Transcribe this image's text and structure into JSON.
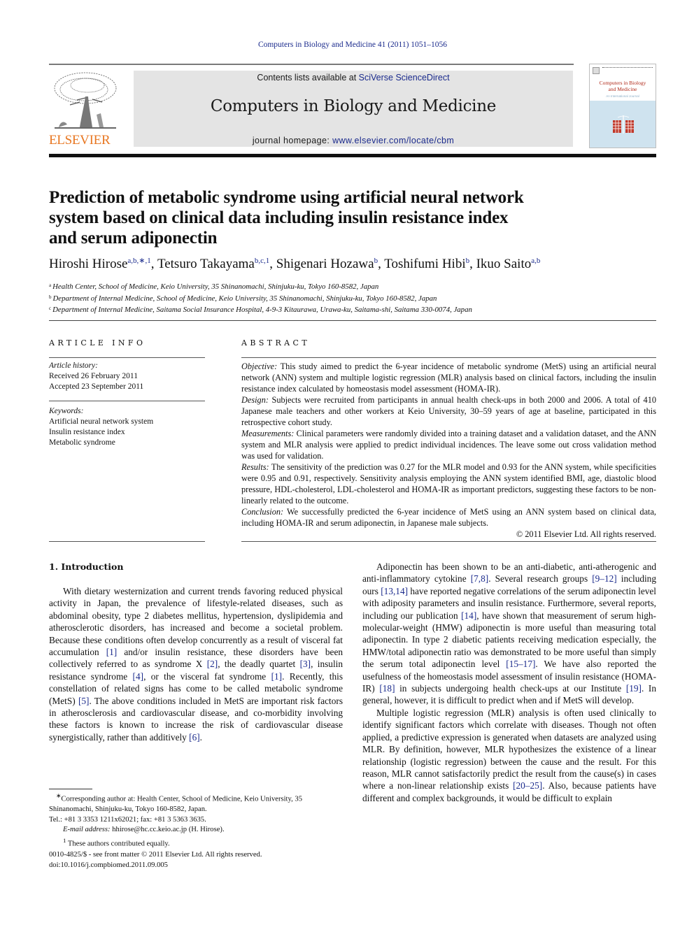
{
  "citation": "Computers in Biology and Medicine 41 (2011) 1051–1056",
  "masthead": {
    "publisher_logo_text": "ELSEVIER",
    "contents_prefix": "Contents lists available at ",
    "contents_link": "SciVerse ScienceDirect",
    "journal_title": "Computers in Biology and Medicine",
    "homepage_prefix": "journal homepage: ",
    "homepage_link": "www.elsevier.com/locate/cbm",
    "cover_title_line1": "Computers in Biology",
    "cover_title_line2": "and Medicine",
    "cover_subtitle": "An International Journal"
  },
  "title_lines": [
    "Prediction of metabolic syndrome using artificial neural network",
    "system based on clinical data including insulin resistance index",
    "and serum adiponectin"
  ],
  "authors": [
    {
      "name": "Hiroshi Hirose",
      "marks": "a,b,∗,1"
    },
    {
      "name": "Tetsuro Takayama",
      "marks": "b,c,1"
    },
    {
      "name": "Shigenari Hozawa",
      "marks": "b"
    },
    {
      "name": "Toshifumi Hibi",
      "marks": "b"
    },
    {
      "name": "Ikuo Saito",
      "marks": "a,b"
    }
  ],
  "affiliations": [
    {
      "mark": "a",
      "text": "Health Center, School of Medicine, Keio University, 35 Shinanomachi, Shinjuku-ku, Tokyo 160-8582, Japan"
    },
    {
      "mark": "b",
      "text": "Department of Internal Medicine, School of Medicine, Keio University, 35 Shinanomachi, Shinjuku-ku, Tokyo 160-8582, Japan"
    },
    {
      "mark": "c",
      "text": "Department of Internal Medicine, Saitama Social Insurance Hospital, 4-9-3 Kitaurawa, Urawa-ku, Saitama-shi, Saitama 330-0074, Japan"
    }
  ],
  "article_info": {
    "heading": "ARTICLE INFO",
    "history_label": "Article history:",
    "received": "Received 26 February 2011",
    "accepted": "Accepted 23 September 2011",
    "keywords_label": "Keywords:",
    "keywords": [
      "Artificial neural network system",
      "Insulin resistance index",
      "Metabolic syndrome"
    ]
  },
  "abstract": {
    "heading": "ABSTRACT",
    "sections": [
      {
        "label": "Objective:",
        "text": " This study aimed to predict the 6-year incidence of metabolic syndrome (MetS) using an artificial neural network (ANN) system and multiple logistic regression (MLR) analysis based on clinical factors, including the insulin resistance index calculated by homeostasis model assessment (HOMA-IR)."
      },
      {
        "label": "Design:",
        "text": " Subjects were recruited from participants in annual health check-ups in both 2000 and 2006. A total of 410 Japanese male teachers and other workers at Keio University, 30–59 years of age at baseline, participated in this retrospective cohort study."
      },
      {
        "label": "Measurements:",
        "text": " Clinical parameters were randomly divided into a training dataset and a validation dataset, and the ANN system and MLR analysis were applied to predict individual incidences. The leave some out cross validation method was used for validation."
      },
      {
        "label": "Results:",
        "text": " The sensitivity of the prediction was 0.27 for the MLR model and 0.93 for the ANN system, while specificities were 0.95 and 0.91, respectively. Sensitivity analysis employing the ANN system identified BMI, age, diastolic blood pressure, HDL-cholesterol, LDL-cholesterol and HOMA-IR as important predictors, suggesting these factors to be non-linearly related to the outcome."
      },
      {
        "label": "Conclusion:",
        "text": " We successfully predicted the 6-year incidence of MetS using an ANN system based on clinical data, including HOMA-IR and serum adiponectin, in Japanese male subjects."
      }
    ],
    "copyright": "© 2011 Elsevier Ltd. All rights reserved."
  },
  "introduction": {
    "heading": "1.   Introduction",
    "left_paragraph": [
      {
        "t": "With dietary westernization and current trends favoring reduced physical activity in Japan, the prevalence of lifestyle-related diseases, such as abdominal obesity, type 2 diabetes mellitus, hypertension, dyslipidemia and atherosclerotic disor­ders, has increased and become a societal problem. Because these conditions often develop concurrently as a result of visceral fat accumulation "
      },
      {
        "ref": "[1]"
      },
      {
        "t": " and/or insulin resistance, these disorders have been collectively referred to as syndrome X "
      },
      {
        "ref": "[2]"
      },
      {
        "t": ", the deadly quartet "
      },
      {
        "ref": "[3]"
      },
      {
        "t": ", insulin resistance syndrome "
      },
      {
        "ref": "[4]"
      },
      {
        "t": ", or the visceral fat syndrome "
      },
      {
        "ref": "[1]"
      },
      {
        "t": ". Recently, this constellation of related signs has come to be called metabolic syndrome (MetS) "
      },
      {
        "ref": "[5]"
      },
      {
        "t": ". The above conditions included in MetS are important risk factors in athero­sclerosis and cardiovascular disease, and co-morbidity involving these factors is known to increase the risk of cardiovascular disease synergistically, rather than additively "
      },
      {
        "ref": "[6]"
      },
      {
        "t": "."
      }
    ],
    "right_paragraph_1": [
      {
        "t": "Adiponectin has been shown to be an anti-diabetic, anti-athero­genic and anti-inflammatory cytokine "
      },
      {
        "ref": "[7,8]"
      },
      {
        "t": ". Several research groups "
      },
      {
        "ref": "[9–12]"
      },
      {
        "t": " including ours "
      },
      {
        "ref": "[13,14]"
      },
      {
        "t": " have reported negative correlations of the serum adiponectin level with adiposity parameters and insulin resistance. Furthermore, several reports, including our publication "
      },
      {
        "ref": "[14]"
      },
      {
        "t": ", have shown that measurement of serum high-molecular-weight (HMW) adiponectin is more useful than measuring total adiponectin. In type 2 diabetic patients receiving medication espe­cially, the HMW/total adiponectin ratio was demonstrated to be more useful than simply the serum total adiponectin level "
      },
      {
        "ref": "[15–17]"
      },
      {
        "t": ". We have also reported the usefulness of the homeostasis model assessment of insulin resistance (HOMA-IR) "
      },
      {
        "ref": "[18]"
      },
      {
        "t": " in subjects under­going health check-ups at our Institute "
      },
      {
        "ref": "[19]"
      },
      {
        "t": ". In general, however, it is difficult to predict when and if MetS will develop."
      }
    ],
    "right_paragraph_2": [
      {
        "t": "Multiple logistic regression (MLR) analysis is often used clinically to identify significant factors which correlate with diseases. Though not often applied, a predictive expression is generated when datasets are analyzed using MLR. By definition, however, MLR hypothesizes the existence of a linear relationship (logistic regres­sion) between the cause and the result. For this reason, MLR cannot satisfactorily predict the result from the cause(s) in cases where a non-linear relationship exists "
      },
      {
        "ref": "[20–25]"
      },
      {
        "t": ". Also, because patients have different and complex backgrounds, it would be difficult to explain"
      }
    ]
  },
  "footnotes": {
    "corresponding_mark": "∗",
    "corresponding": "Corresponding author at: Health Center, School of Medicine, Keio University, 35 Shinanomachi, Shinjuku-ku, Tokyo 160-8582, Japan.",
    "tel": "Tel.: +81 3 3353 1211x62021; fax: +81 3 5363 3635.",
    "email_label": "E-mail address:",
    "email": " hhirose@hc.cc.keio.ac.jp (H. Hirose).",
    "equal_mark": "1",
    "equal": " These authors contributed equally."
  },
  "issn": "0010-4825/$ - see front matter © 2011 Elsevier Ltd. All rights reserved.",
  "doi": "doi:10.1016/j.compbiomed.2011.09.005"
}
